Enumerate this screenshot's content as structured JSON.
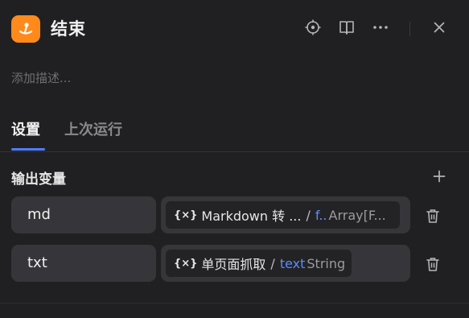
{
  "header": {
    "title": "结束",
    "logo_color": "#ff8a1c",
    "actions": [
      "locate-icon",
      "book-icon",
      "more-icon",
      "close-icon"
    ]
  },
  "description_placeholder": "添加描述...",
  "tabs": [
    {
      "label": "设置",
      "active": true
    },
    {
      "label": "上次运行",
      "active": false
    }
  ],
  "section": {
    "title": "输出变量"
  },
  "outputs": [
    {
      "name": "md",
      "value": {
        "var_icon": "{×}",
        "node": "Markdown 转 ...",
        "field": "f..",
        "type": "Array[F..."
      }
    },
    {
      "name": "txt",
      "value": {
        "var_icon": "{×}",
        "node": "单页面抓取",
        "field": "text",
        "type": "String"
      }
    }
  ],
  "colors": {
    "accent": "#4d7cfe",
    "field_blue": "#5b8cff",
    "background": "#202022"
  }
}
